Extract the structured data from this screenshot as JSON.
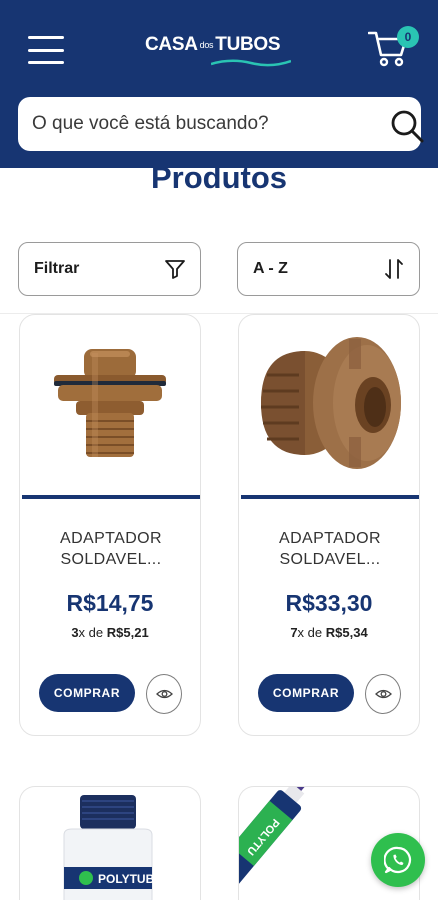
{
  "header": {
    "brand_prefix": "CASA",
    "brand_middle": "dos",
    "brand_suffix": "TUBOS",
    "cart_count": "0",
    "colors": {
      "header_bg": "#173572",
      "badge": "#2ac4b3"
    },
    "icons": [
      "hamburger-menu-icon",
      "cart-icon"
    ]
  },
  "search": {
    "placeholder": "O que você está buscando?",
    "value": "",
    "icon": "search-icon"
  },
  "page": {
    "title": "Produtos"
  },
  "controls": {
    "filter_label": "Filtrar",
    "filter_icon": "funnel-icon",
    "sort_label": "A - Z",
    "sort_icon": "sort-arrows-icon"
  },
  "products": [
    {
      "name_line1": "ADAPTADOR",
      "name_line2": "SOLDAVEL...",
      "price": "R$14,75",
      "installments": "3",
      "installment_sep": "x de",
      "installment_value": "R$5,21",
      "buy_label": "COMPRAR",
      "view_icon": "eye-icon"
    },
    {
      "name_line1": "ADAPTADOR",
      "name_line2": "SOLDAVEL...",
      "price": "R$33,30",
      "installments": "7",
      "installment_sep": "x de",
      "installment_value": "R$5,34",
      "buy_label": "COMPRAR",
      "view_icon": "eye-icon"
    },
    {
      "label_text": "POLYTUBES"
    },
    {
      "label_text": "POLYTU"
    }
  ],
  "floating": {
    "icon": "whatsapp-icon",
    "color": "#2fbf4e"
  }
}
